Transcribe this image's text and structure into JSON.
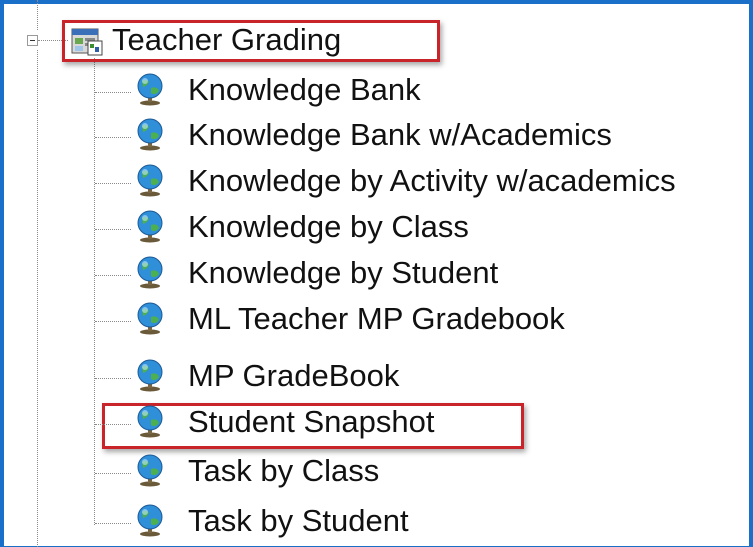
{
  "tree": {
    "root": {
      "label": "Teacher Grading",
      "icon": "report-folder-icon",
      "expanded": true
    },
    "children": [
      {
        "label": "Knowledge Bank",
        "icon": "globe-icon"
      },
      {
        "label": "Knowledge Bank w/Academics",
        "icon": "globe-icon"
      },
      {
        "label": "Knowledge by Activity w/academics",
        "icon": "globe-icon"
      },
      {
        "label": "Knowledge by Class",
        "icon": "globe-icon"
      },
      {
        "label": "Knowledge by Student",
        "icon": "globe-icon"
      },
      {
        "label": "ML Teacher MP Gradebook",
        "icon": "globe-icon"
      },
      {
        "label": "MP GradeBook",
        "icon": "globe-icon"
      },
      {
        "label": "Student Snapshot",
        "icon": "globe-icon"
      },
      {
        "label": "Task by Class",
        "icon": "globe-icon"
      },
      {
        "label": "Task by Student",
        "icon": "globe-icon"
      }
    ]
  },
  "colors": {
    "frame": "#1a6fc9",
    "highlight": "#c8242a"
  }
}
